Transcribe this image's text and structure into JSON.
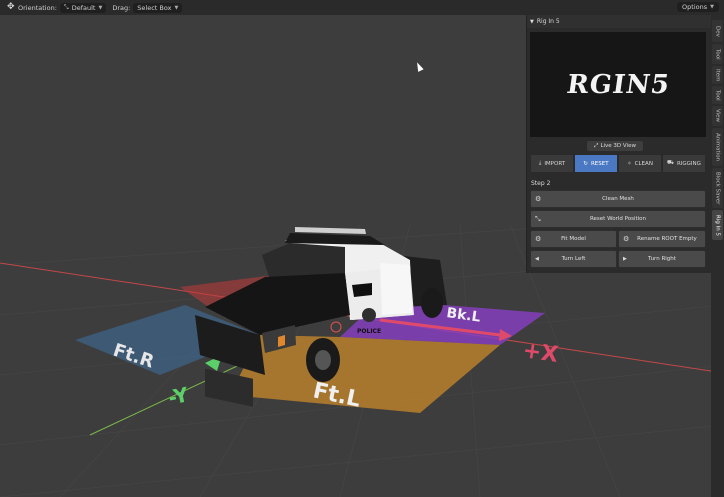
{
  "toolbar": {
    "orientation_label": "Orientation:",
    "orientation_value": "Default",
    "drag_label": "Drag:",
    "drag_value": "Select Box",
    "options_label": "Options"
  },
  "viewport": {
    "labels": {
      "ft_r": "Ft.R",
      "ft_l": "Ft.L",
      "bk_l": "Bk.L",
      "plus_x": "+X",
      "minus_y": "-Y"
    },
    "vehicle_badge": "POLICE",
    "colors": {
      "background": "#3d3d3d",
      "grid": "#4a4a4a",
      "x_axis": "#c24848",
      "y_axis": "#7bb84a",
      "zone_ft_r": "#3f6c9a",
      "zone_ft_l": "#c9892b",
      "zone_bk_l": "#8a3fc7",
      "zone_bk_r": "#c23b3b"
    }
  },
  "sidebar_tabs": [
    "Item",
    "Tool",
    "View",
    "Animation",
    "Block Saver",
    "Rig In 5",
    "Dev",
    "Tool"
  ],
  "panel": {
    "title": "Rig In 5",
    "logo_text": "RGIN5",
    "live_view_label": "Live 3D View",
    "tabs": [
      {
        "label": "IMPORT",
        "icon": "import-icon"
      },
      {
        "label": "RESET",
        "icon": "reset-icon"
      },
      {
        "label": "CLEAN",
        "icon": "clean-icon"
      },
      {
        "label": "RIGGING",
        "icon": "car-icon"
      }
    ],
    "step_label": "Step 2",
    "buttons": {
      "clean_mesh": "Clean Mesh",
      "reset_world": "Reset World Position",
      "fit_model": "Fit Model",
      "rename_root": "Rename ROOT Empty",
      "turn_left": "Turn Left",
      "turn_right": "Turn Right"
    }
  }
}
